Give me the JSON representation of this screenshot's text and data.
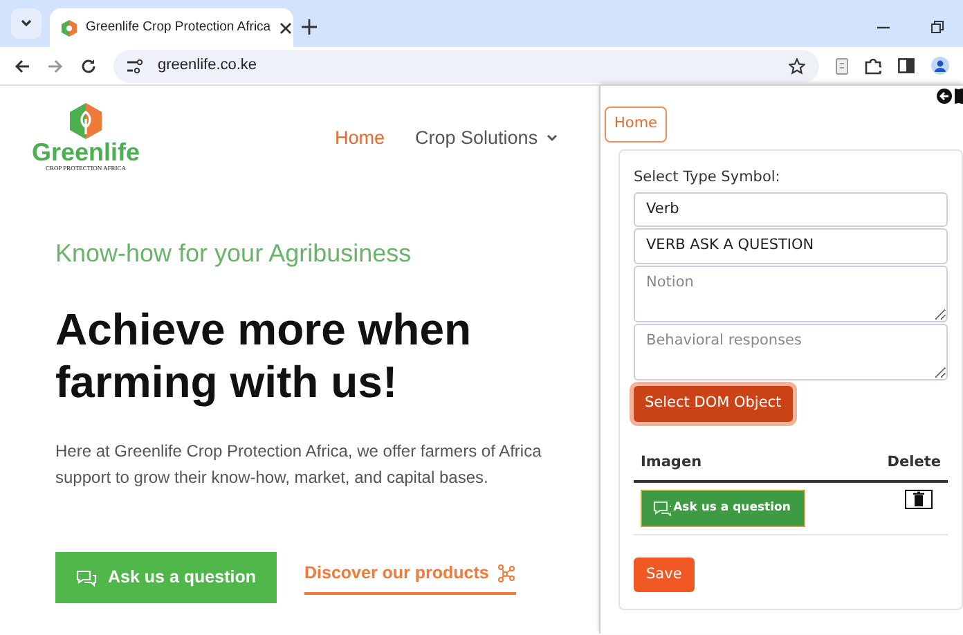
{
  "browser": {
    "tabs": [
      {
        "title": "Greenlife Crop Protection Africa",
        "selected": true
      }
    ],
    "url": "greenlife.co.ke"
  },
  "website": {
    "logo": {
      "name": "Greenlife",
      "tagline": "CROP PROTECTION AFRICA"
    },
    "nav": [
      {
        "label": "Home",
        "selected": true,
        "dropdown": false
      },
      {
        "label": "Crop Solutions",
        "selected": false,
        "dropdown": true
      }
    ],
    "kicker": "Know-how for your Agribusiness",
    "headline": "Achieve more when farming with us!",
    "body": "Here at Greenlife Crop Protection Africa, we offer farmers of Africa support to grow their know-how, market, and capital bases.",
    "buttons": [
      {
        "label": "Ask us a question",
        "kind": "primary"
      },
      {
        "label": "Discover our products",
        "kind": "link"
      }
    ]
  },
  "panel": {
    "home_button": "Home",
    "form_label": "Select Type Symbol:",
    "fields": [
      {
        "kind": "input",
        "value": "Verb"
      },
      {
        "kind": "input",
        "value": "VERB ASK A QUESTION"
      },
      {
        "kind": "textarea",
        "placeholder": "Notion"
      },
      {
        "kind": "textarea",
        "placeholder": "Behavioral responses"
      }
    ],
    "select_button": "Select DOM Object",
    "table": {
      "columns": [
        "Imagen",
        "Delete"
      ],
      "rows": [
        {
          "image_label": "Ask us a question"
        }
      ]
    },
    "save_button": "Save"
  }
}
